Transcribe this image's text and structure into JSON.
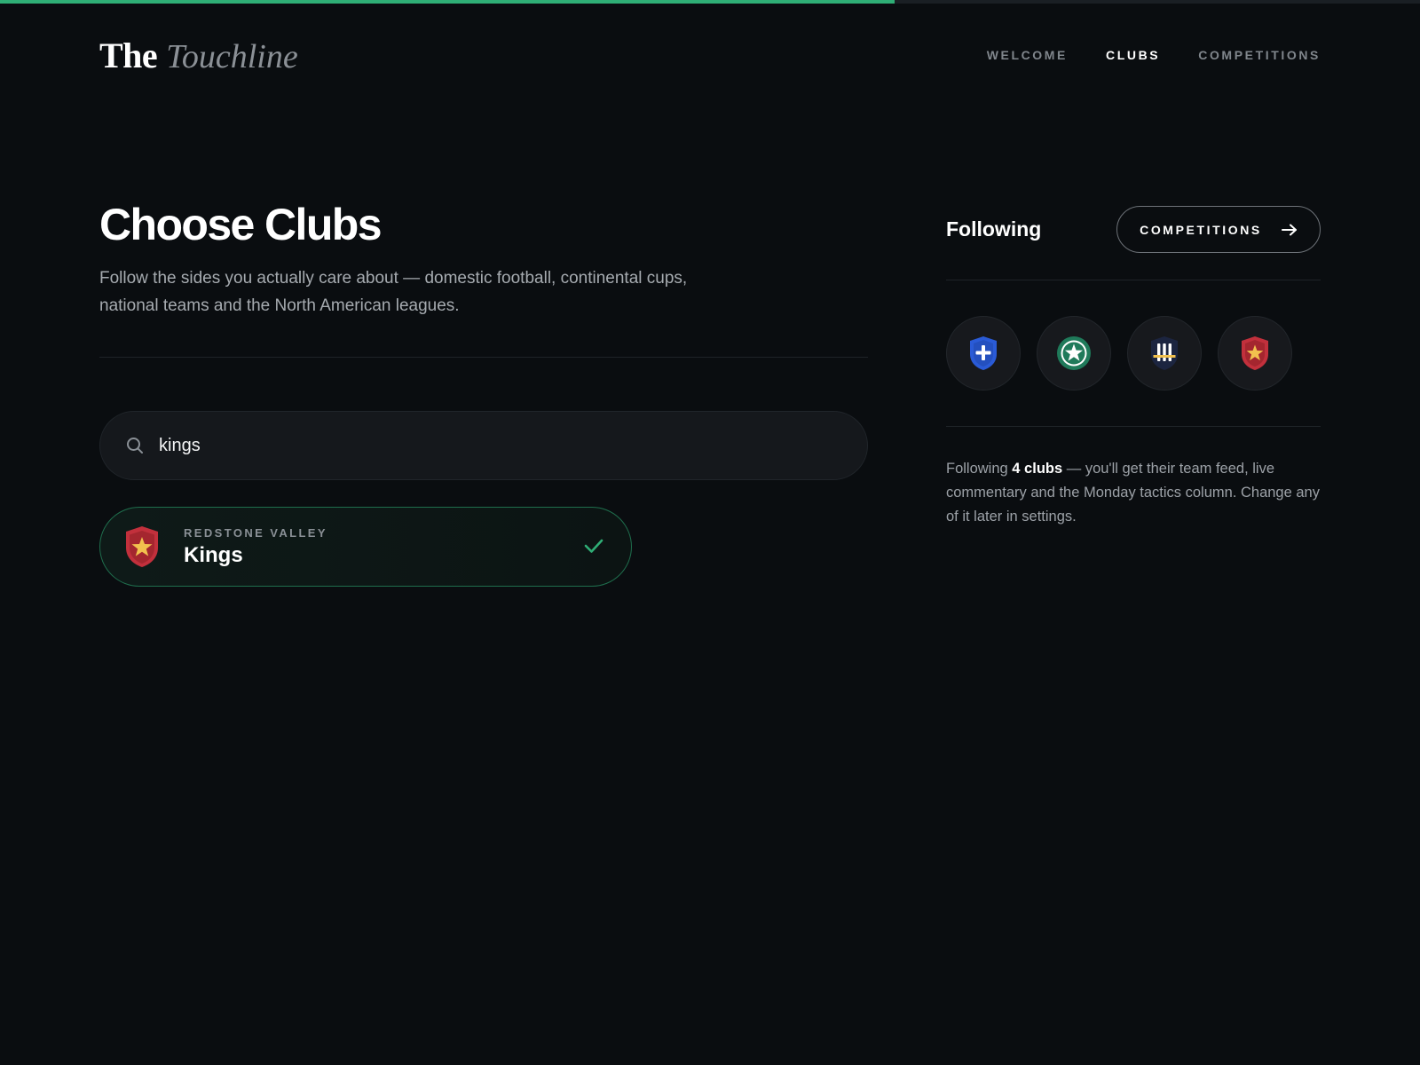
{
  "progress": {
    "fraction": 0.63,
    "color": "#2fae76"
  },
  "brand": {
    "the": "The",
    "touchline": "Touchline"
  },
  "nav": [
    {
      "label": "WELCOME",
      "active": false
    },
    {
      "label": "CLUBS",
      "active": true
    },
    {
      "label": "COMPETITIONS",
      "active": false
    }
  ],
  "main": {
    "title": "Choose Clubs",
    "subtitle": "Follow the sides you actually care about — domestic football, continental cups, national teams and the North American leagues."
  },
  "search": {
    "value": "kings",
    "icon": "search-icon"
  },
  "results": [
    {
      "region": "REDSTONE VALLEY",
      "name": "Kings",
      "selected": true,
      "crest": "red-shield-star-crest"
    }
  ],
  "side": {
    "title": "Following",
    "competitions_button": "COMPETITIONS",
    "followed_crests": [
      "blue-shield-cross-crest",
      "green-circle-star-crest",
      "navy-stripes-crest",
      "red-shield-star-crest"
    ],
    "note_prefix": "Following ",
    "note_count": "4 clubs",
    "note_suffix": " — you'll get their team feed, live commentary and the Monday tactics column. Change any of it later in settings."
  },
  "colors": {
    "accent": "#2fae76",
    "background": "#0a0d10",
    "blue_crest": "#2a5bd7",
    "green_crest": "#1f7a5a",
    "red_crest": "#c2303c",
    "gold": "#f2c14e"
  }
}
